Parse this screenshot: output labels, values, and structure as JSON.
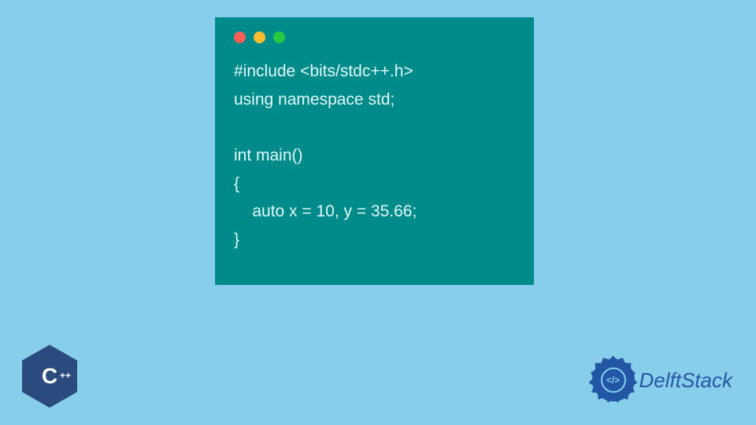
{
  "code": {
    "lines": [
      "#include <bits/stdc++.h>",
      "using namespace std;",
      "",
      "int main()",
      "{",
      "    auto x = 10, y = 35.66;",
      "}"
    ]
  },
  "cpp_logo": {
    "main": "C",
    "suffix": "++"
  },
  "brand": {
    "name": "DelftStack",
    "icon_glyph": "</>"
  }
}
